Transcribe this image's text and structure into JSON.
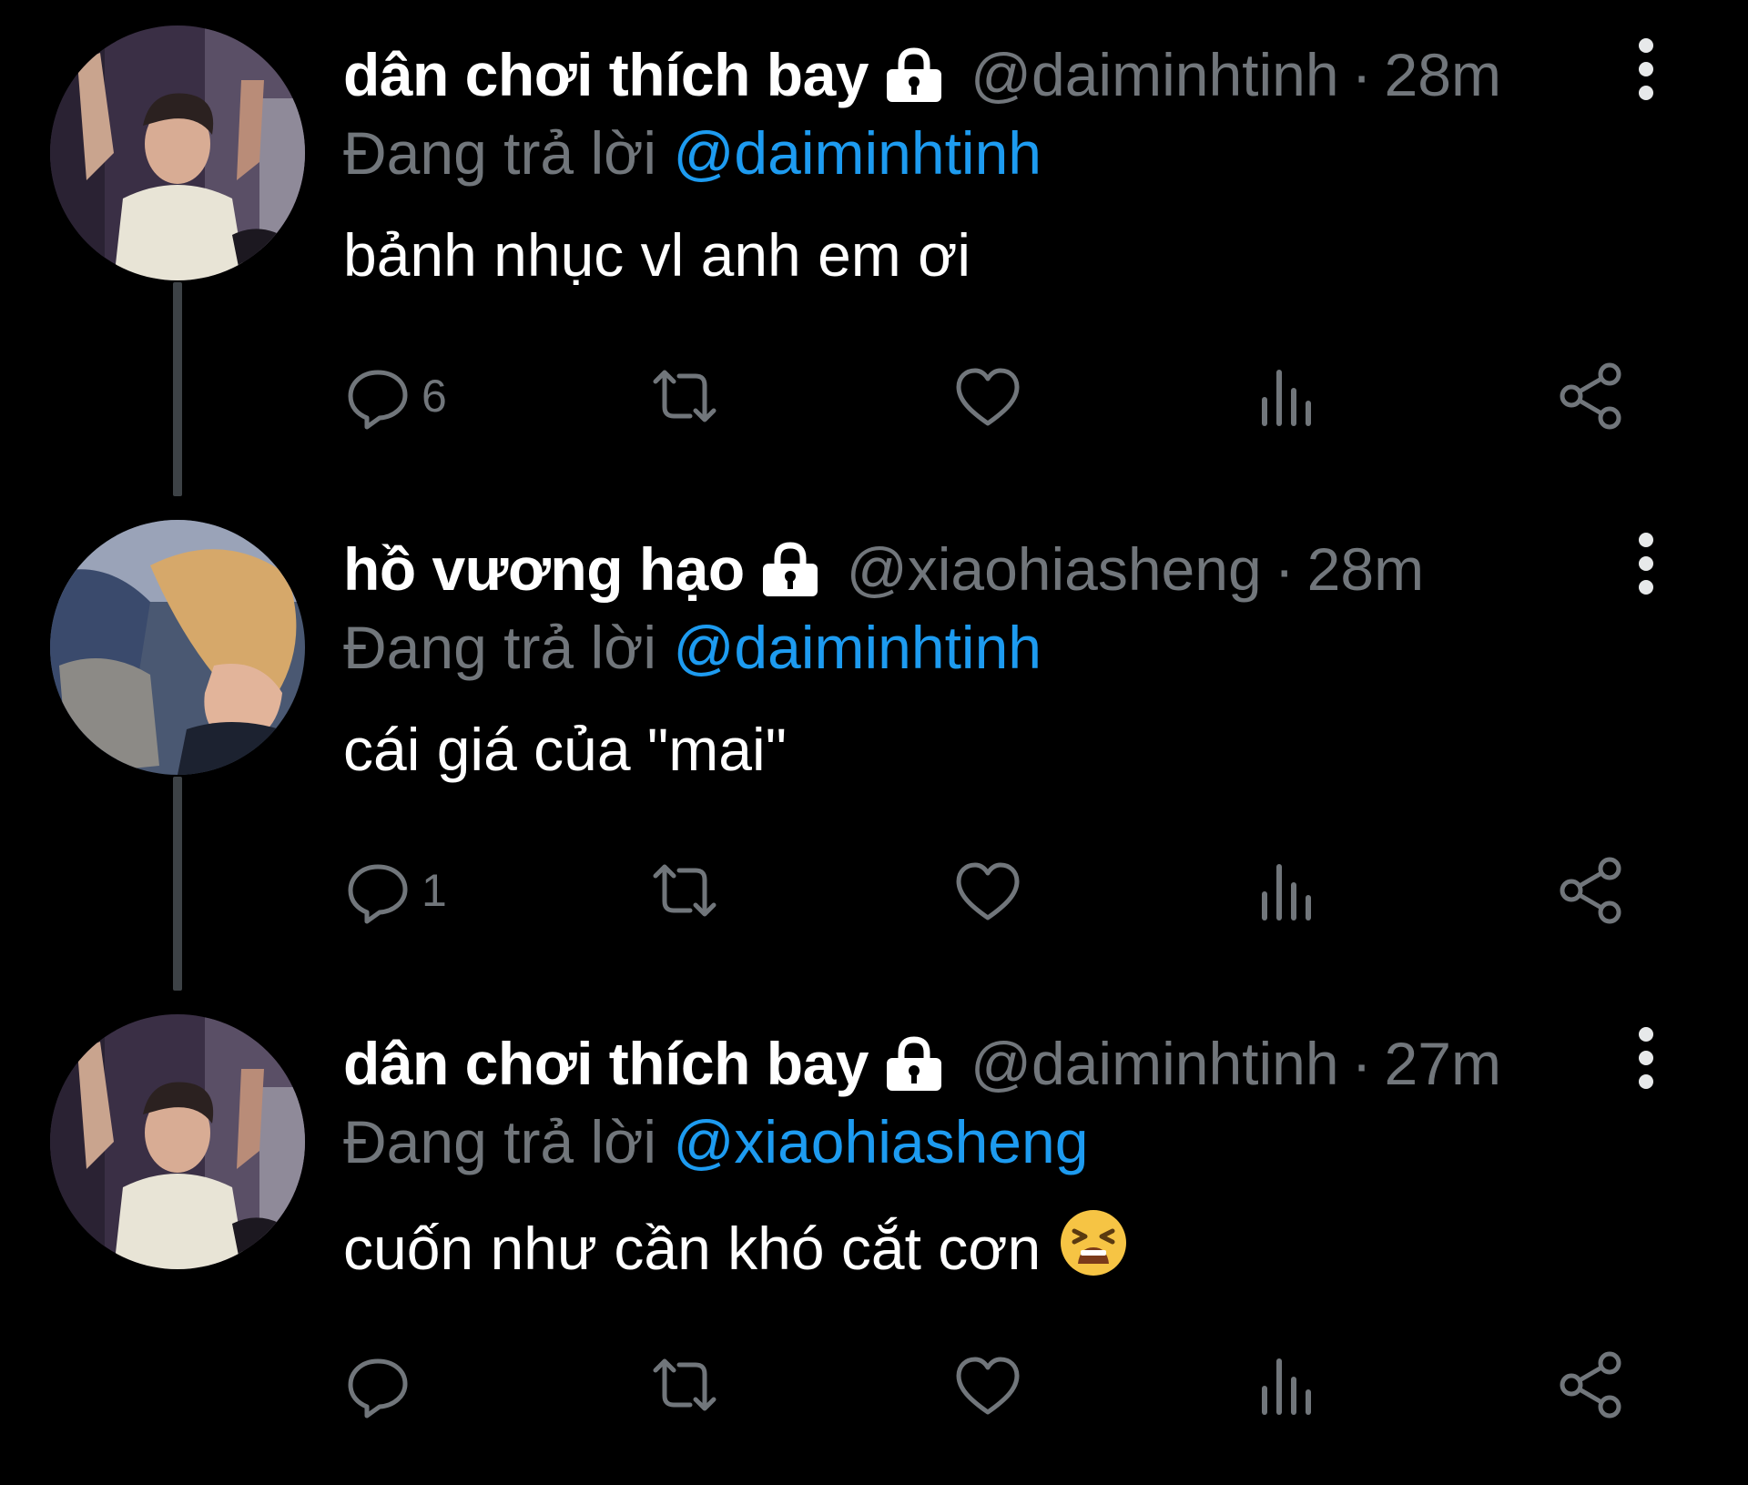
{
  "colors": {
    "background": "#000000",
    "text_primary": "#ffffff",
    "text_secondary": "#71767b",
    "link": "#1d9bf0",
    "thread_line": "#3d4246"
  },
  "thread": [
    {
      "display_name": "dân chơi thích bay",
      "protected_icon": "lock-icon",
      "handle": "@daiminhtinh",
      "separator": "·",
      "time": "28m",
      "reply_prefix": "Đang trả lời",
      "reply_to": "@daiminhtinh",
      "text": "bảnh nhục vl anh em ơi",
      "emoji": "",
      "reply_count": "6"
    },
    {
      "display_name": "hồ vương hạo",
      "protected_icon": "lock-icon",
      "handle": "@xiaohiasheng",
      "separator": "·",
      "time": "28m",
      "reply_prefix": "Đang trả lời",
      "reply_to": "@daiminhtinh",
      "text": "cái giá của \"mai\"",
      "emoji": "",
      "reply_count": "1"
    },
    {
      "display_name": "dân chơi thích bay",
      "protected_icon": "lock-icon",
      "handle": "@daiminhtinh",
      "separator": "·",
      "time": "27m",
      "reply_prefix": "Đang trả lời",
      "reply_to": "@xiaohiasheng",
      "text": "cuốn như cần khó cắt cơn ",
      "emoji": "tired-face-emoji",
      "reply_count": ""
    }
  ],
  "action_icons": [
    "reply-icon",
    "retweet-icon",
    "like-icon",
    "views-icon",
    "share-icon"
  ]
}
